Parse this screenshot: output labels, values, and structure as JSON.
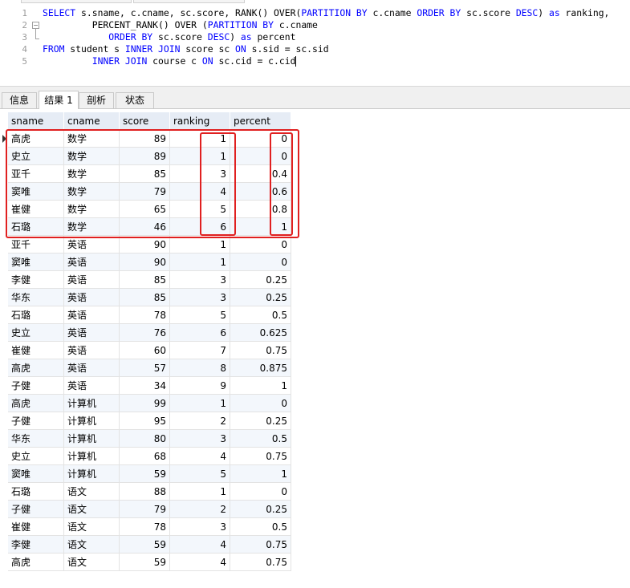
{
  "editor": {
    "line_numbers": [
      "1",
      "2",
      "3",
      "4",
      "5"
    ],
    "lines": [
      [
        {
          "t": "SELECT",
          "k": 1
        },
        {
          "t": " s.sname, c.cname, sc.score, RANK() OVER(",
          "k": 0
        },
        {
          "t": "PARTITION BY",
          "k": 1
        },
        {
          "t": " c.cname ",
          "k": 0
        },
        {
          "t": "ORDER BY",
          "k": 1
        },
        {
          "t": " sc.score ",
          "k": 0
        },
        {
          "t": "DESC",
          "k": 1
        },
        {
          "t": ") ",
          "k": 0
        },
        {
          "t": "as",
          "k": 1
        },
        {
          "t": " ranking,",
          "k": 0
        }
      ],
      [
        {
          "t": "         PERCENT_RANK() OVER (",
          "k": 0
        },
        {
          "t": "PARTITION BY",
          "k": 1
        },
        {
          "t": " c.cname",
          "k": 0
        }
      ],
      [
        {
          "t": "            ",
          "k": 0
        },
        {
          "t": "ORDER BY",
          "k": 1
        },
        {
          "t": " sc.score ",
          "k": 0
        },
        {
          "t": "DESC",
          "k": 1
        },
        {
          "t": ") ",
          "k": 0
        },
        {
          "t": "as",
          "k": 1
        },
        {
          "t": " percent",
          "k": 0
        }
      ],
      [
        {
          "t": "FROM",
          "k": 1
        },
        {
          "t": " student s ",
          "k": 0
        },
        {
          "t": "INNER JOIN",
          "k": 1
        },
        {
          "t": " score sc ",
          "k": 0
        },
        {
          "t": "ON",
          "k": 1
        },
        {
          "t": " s.sid = sc.sid",
          "k": 0
        }
      ],
      [
        {
          "t": "         ",
          "k": 0
        },
        {
          "t": "INNER JOIN",
          "k": 1
        },
        {
          "t": " course c ",
          "k": 0
        },
        {
          "t": "ON",
          "k": 1
        },
        {
          "t": " sc.cid = c.cid",
          "k": 0
        }
      ]
    ]
  },
  "tabs": {
    "info": "信息",
    "result1": "结果 1",
    "profile": "剖析",
    "status": "状态"
  },
  "grid": {
    "columns": [
      "sname",
      "cname",
      "score",
      "ranking",
      "percent"
    ],
    "rows": [
      [
        "高虎",
        "数学",
        "89",
        "1",
        "0"
      ],
      [
        "史立",
        "数学",
        "89",
        "1",
        "0"
      ],
      [
        "亚千",
        "数学",
        "85",
        "3",
        "0.4"
      ],
      [
        "窦唯",
        "数学",
        "79",
        "4",
        "0.6"
      ],
      [
        "崔健",
        "数学",
        "65",
        "5",
        "0.8"
      ],
      [
        "石璐",
        "数学",
        "46",
        "6",
        "1"
      ],
      [
        "亚千",
        "英语",
        "90",
        "1",
        "0"
      ],
      [
        "窦唯",
        "英语",
        "90",
        "1",
        "0"
      ],
      [
        "李健",
        "英语",
        "85",
        "3",
        "0.25"
      ],
      [
        "华东",
        "英语",
        "85",
        "3",
        "0.25"
      ],
      [
        "石璐",
        "英语",
        "78",
        "5",
        "0.5"
      ],
      [
        "史立",
        "英语",
        "76",
        "6",
        "0.625"
      ],
      [
        "崔健",
        "英语",
        "60",
        "7",
        "0.75"
      ],
      [
        "高虎",
        "英语",
        "57",
        "8",
        "0.875"
      ],
      [
        "子健",
        "英语",
        "34",
        "9",
        "1"
      ],
      [
        "高虎",
        "计算机",
        "99",
        "1",
        "0"
      ],
      [
        "子健",
        "计算机",
        "95",
        "2",
        "0.25"
      ],
      [
        "华东",
        "计算机",
        "80",
        "3",
        "0.5"
      ],
      [
        "史立",
        "计算机",
        "68",
        "4",
        "0.75"
      ],
      [
        "窦唯",
        "计算机",
        "59",
        "5",
        "1"
      ],
      [
        "石璐",
        "语文",
        "88",
        "1",
        "0"
      ],
      [
        "子健",
        "语文",
        "79",
        "2",
        "0.25"
      ],
      [
        "崔健",
        "语文",
        "78",
        "3",
        "0.5"
      ],
      [
        "李健",
        "语文",
        "59",
        "4",
        "0.75"
      ],
      [
        "高虎",
        "语文",
        "59",
        "4",
        "0.75"
      ]
    ]
  },
  "colors": {
    "keyword": "#0000ff",
    "highlight_box": "#e02020",
    "header_bg": "#e6ecf5",
    "alt_row_bg": "#f3f7fc"
  }
}
